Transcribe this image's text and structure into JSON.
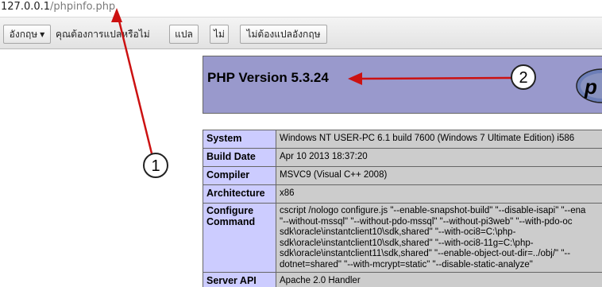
{
  "browser": {
    "url_host": "127.0.0.1",
    "url_path": "/phpinfo.php"
  },
  "translate_bar": {
    "language_select": "อังกฤษ",
    "prompt": "คุณต้องการแปลหรือไม่",
    "translate_button": "แปล",
    "no_button": "ไม่",
    "never_button": "ไม่ต้องแปลอังกฤษ"
  },
  "phpinfo": {
    "title": "PHP Version 5.3.24",
    "rows": [
      {
        "key": "System",
        "value": "Windows NT USER-PC 6.1 build 7600 (Windows 7 Ultimate Edition) i586"
      },
      {
        "key": "Build Date",
        "value": "Apr 10 2013 18:37:20"
      },
      {
        "key": "Compiler",
        "value": "MSVC9 (Visual C++ 2008)"
      },
      {
        "key": "Architecture",
        "value": "x86"
      },
      {
        "key": "Configure\nCommand",
        "value": "cscript /nologo configure.js \"--enable-snapshot-build\" \"--disable-isapi\" \"--ena\n\"--without-mssql\" \"--without-pdo-mssql\" \"--without-pi3web\" \"--with-pdo-oc\nsdk\\oracle\\instantclient10\\sdk,shared\" \"--with-oci8=C:\\php-\nsdk\\oracle\\instantclient10\\sdk,shared\" \"--with-oci8-11g=C:\\php-\nsdk\\oracle\\instantclient11\\sdk,shared\" \"--enable-object-out-dir=../obj/\" \"--\ndotnet=shared\" \"--with-mcrypt=static\" \"--disable-static-analyze\""
      },
      {
        "key": "Server API",
        "value": "Apache 2.0 Handler"
      }
    ]
  },
  "annotations": {
    "marker_1": "1",
    "marker_2": "2",
    "arrow_color": "#cc1111"
  }
}
